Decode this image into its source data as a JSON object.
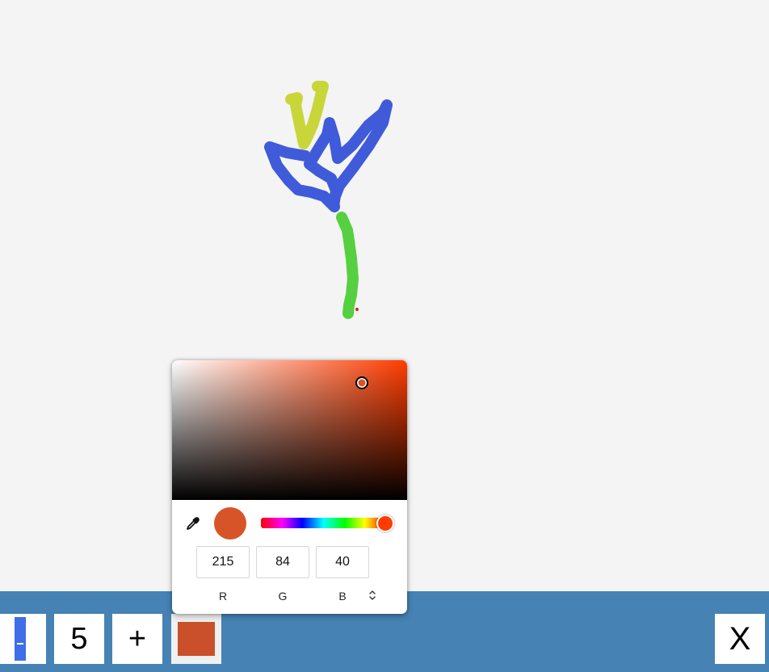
{
  "toolbar": {
    "size_value": "5",
    "plus_label": "+",
    "close_label": "X",
    "current_color": "#c9502a",
    "background": "#4682b4"
  },
  "color_picker": {
    "hue_color": "#ff3c00",
    "preview_color": "#d75428",
    "channels": [
      {
        "label": "R",
        "value": "215"
      },
      {
        "label": "G",
        "value": "84"
      },
      {
        "label": "B",
        "value": "40"
      }
    ],
    "eyedropper_icon": "eyedropper-icon",
    "mode_toggle_icon": "chevron-up-down-icon"
  },
  "drawing": {
    "stroke_colors": [
      "#c8d639",
      "#3f5bd9",
      "#56cf40",
      "#e0201b"
    ]
  }
}
